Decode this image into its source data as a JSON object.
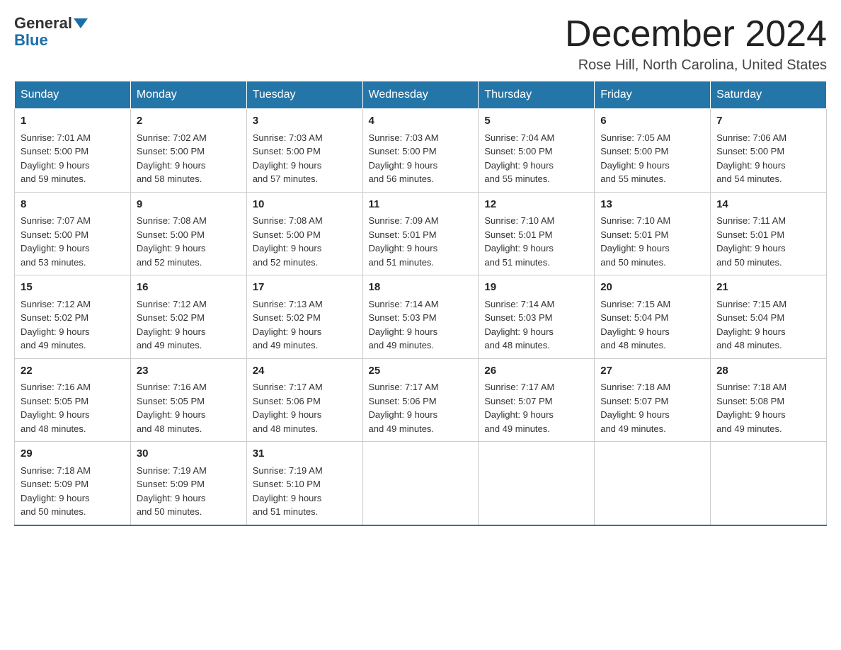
{
  "header": {
    "logo_general": "General",
    "logo_blue": "Blue",
    "month_title": "December 2024",
    "subtitle": "Rose Hill, North Carolina, United States"
  },
  "days_of_week": [
    "Sunday",
    "Monday",
    "Tuesday",
    "Wednesday",
    "Thursday",
    "Friday",
    "Saturday"
  ],
  "weeks": [
    [
      {
        "day": "1",
        "sunrise": "7:01 AM",
        "sunset": "5:00 PM",
        "daylight": "9 hours and 59 minutes."
      },
      {
        "day": "2",
        "sunrise": "7:02 AM",
        "sunset": "5:00 PM",
        "daylight": "9 hours and 58 minutes."
      },
      {
        "day": "3",
        "sunrise": "7:03 AM",
        "sunset": "5:00 PM",
        "daylight": "9 hours and 57 minutes."
      },
      {
        "day": "4",
        "sunrise": "7:03 AM",
        "sunset": "5:00 PM",
        "daylight": "9 hours and 56 minutes."
      },
      {
        "day": "5",
        "sunrise": "7:04 AM",
        "sunset": "5:00 PM",
        "daylight": "9 hours and 55 minutes."
      },
      {
        "day": "6",
        "sunrise": "7:05 AM",
        "sunset": "5:00 PM",
        "daylight": "9 hours and 55 minutes."
      },
      {
        "day": "7",
        "sunrise": "7:06 AM",
        "sunset": "5:00 PM",
        "daylight": "9 hours and 54 minutes."
      }
    ],
    [
      {
        "day": "8",
        "sunrise": "7:07 AM",
        "sunset": "5:00 PM",
        "daylight": "9 hours and 53 minutes."
      },
      {
        "day": "9",
        "sunrise": "7:08 AM",
        "sunset": "5:00 PM",
        "daylight": "9 hours and 52 minutes."
      },
      {
        "day": "10",
        "sunrise": "7:08 AM",
        "sunset": "5:00 PM",
        "daylight": "9 hours and 52 minutes."
      },
      {
        "day": "11",
        "sunrise": "7:09 AM",
        "sunset": "5:01 PM",
        "daylight": "9 hours and 51 minutes."
      },
      {
        "day": "12",
        "sunrise": "7:10 AM",
        "sunset": "5:01 PM",
        "daylight": "9 hours and 51 minutes."
      },
      {
        "day": "13",
        "sunrise": "7:10 AM",
        "sunset": "5:01 PM",
        "daylight": "9 hours and 50 minutes."
      },
      {
        "day": "14",
        "sunrise": "7:11 AM",
        "sunset": "5:01 PM",
        "daylight": "9 hours and 50 minutes."
      }
    ],
    [
      {
        "day": "15",
        "sunrise": "7:12 AM",
        "sunset": "5:02 PM",
        "daylight": "9 hours and 49 minutes."
      },
      {
        "day": "16",
        "sunrise": "7:12 AM",
        "sunset": "5:02 PM",
        "daylight": "9 hours and 49 minutes."
      },
      {
        "day": "17",
        "sunrise": "7:13 AM",
        "sunset": "5:02 PM",
        "daylight": "9 hours and 49 minutes."
      },
      {
        "day": "18",
        "sunrise": "7:14 AM",
        "sunset": "5:03 PM",
        "daylight": "9 hours and 49 minutes."
      },
      {
        "day": "19",
        "sunrise": "7:14 AM",
        "sunset": "5:03 PM",
        "daylight": "9 hours and 48 minutes."
      },
      {
        "day": "20",
        "sunrise": "7:15 AM",
        "sunset": "5:04 PM",
        "daylight": "9 hours and 48 minutes."
      },
      {
        "day": "21",
        "sunrise": "7:15 AM",
        "sunset": "5:04 PM",
        "daylight": "9 hours and 48 minutes."
      }
    ],
    [
      {
        "day": "22",
        "sunrise": "7:16 AM",
        "sunset": "5:05 PM",
        "daylight": "9 hours and 48 minutes."
      },
      {
        "day": "23",
        "sunrise": "7:16 AM",
        "sunset": "5:05 PM",
        "daylight": "9 hours and 48 minutes."
      },
      {
        "day": "24",
        "sunrise": "7:17 AM",
        "sunset": "5:06 PM",
        "daylight": "9 hours and 48 minutes."
      },
      {
        "day": "25",
        "sunrise": "7:17 AM",
        "sunset": "5:06 PM",
        "daylight": "9 hours and 49 minutes."
      },
      {
        "day": "26",
        "sunrise": "7:17 AM",
        "sunset": "5:07 PM",
        "daylight": "9 hours and 49 minutes."
      },
      {
        "day": "27",
        "sunrise": "7:18 AM",
        "sunset": "5:07 PM",
        "daylight": "9 hours and 49 minutes."
      },
      {
        "day": "28",
        "sunrise": "7:18 AM",
        "sunset": "5:08 PM",
        "daylight": "9 hours and 49 minutes."
      }
    ],
    [
      {
        "day": "29",
        "sunrise": "7:18 AM",
        "sunset": "5:09 PM",
        "daylight": "9 hours and 50 minutes."
      },
      {
        "day": "30",
        "sunrise": "7:19 AM",
        "sunset": "5:09 PM",
        "daylight": "9 hours and 50 minutes."
      },
      {
        "day": "31",
        "sunrise": "7:19 AM",
        "sunset": "5:10 PM",
        "daylight": "9 hours and 51 minutes."
      },
      null,
      null,
      null,
      null
    ]
  ],
  "labels": {
    "sunrise": "Sunrise:",
    "sunset": "Sunset:",
    "daylight": "Daylight:"
  }
}
